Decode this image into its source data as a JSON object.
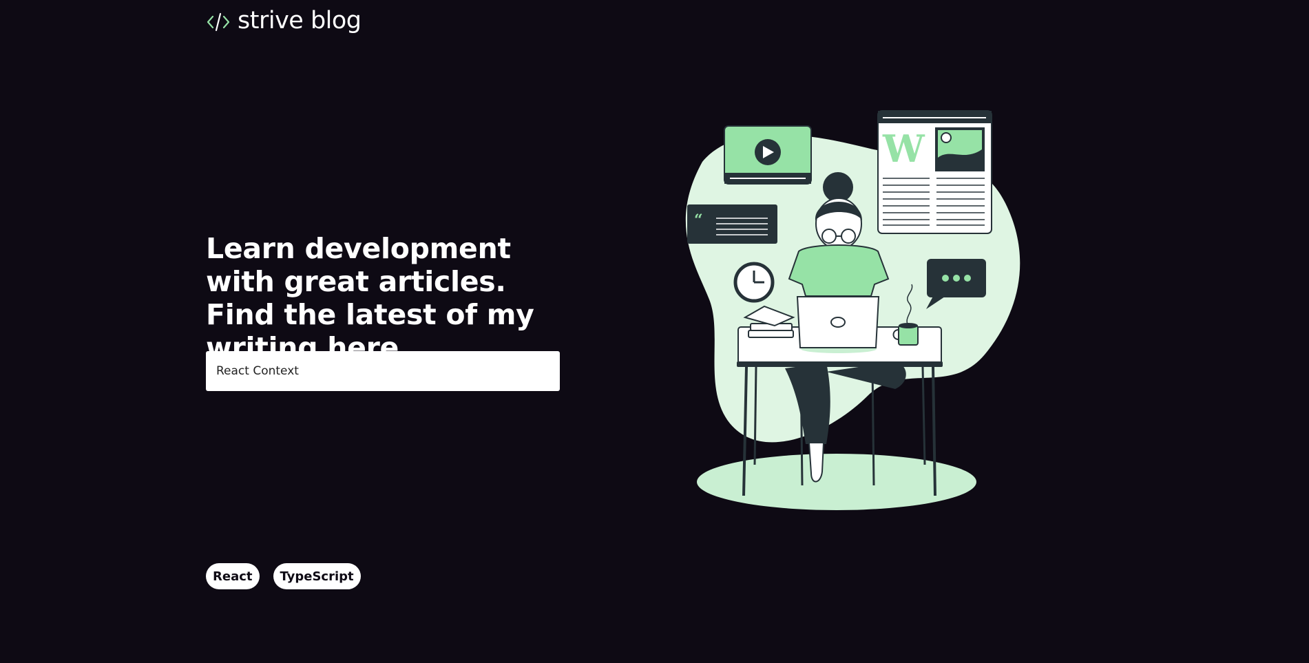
{
  "header": {
    "logo_icon": "code-brackets-icon",
    "brand": "strive blog"
  },
  "hero": {
    "title": "Learn development with great articles. Find the latest of my writing here."
  },
  "search": {
    "value": "React Context",
    "placeholder": "React Context"
  },
  "tags": [
    "React",
    "TypeScript"
  ],
  "illustration": {
    "icon": "developer-at-desk-illustration",
    "wiki_letter": "W"
  },
  "colors": {
    "background": "#0e0a14",
    "accent": "#96e2a6",
    "accent_light": "#dff5e3",
    "dark": "#263238",
    "text": "#ffffff"
  }
}
